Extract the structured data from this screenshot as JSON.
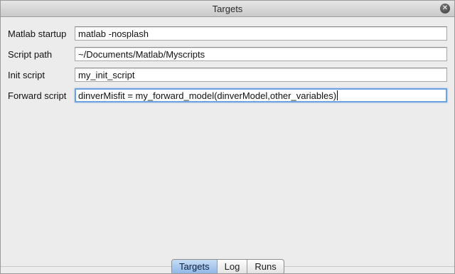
{
  "window": {
    "title": "Targets"
  },
  "form": {
    "rows": [
      {
        "label": "Matlab startup",
        "value": "matlab -nosplash"
      },
      {
        "label": "Script path",
        "value": "~/Documents/Matlab/Myscripts"
      },
      {
        "label": "Init script",
        "value": "my_init_script"
      },
      {
        "label": "Forward script",
        "value": "dinverMisfit = my_forward_model(dinverModel,other_variables)"
      }
    ]
  },
  "tabs": [
    {
      "label": "Targets",
      "active": true
    },
    {
      "label": "Log",
      "active": false
    },
    {
      "label": "Runs",
      "active": false
    }
  ],
  "colors": {
    "accent": "#8fb6e6",
    "focus_ring": "#6ea2e0"
  },
  "icons": {
    "close": "close-icon"
  }
}
